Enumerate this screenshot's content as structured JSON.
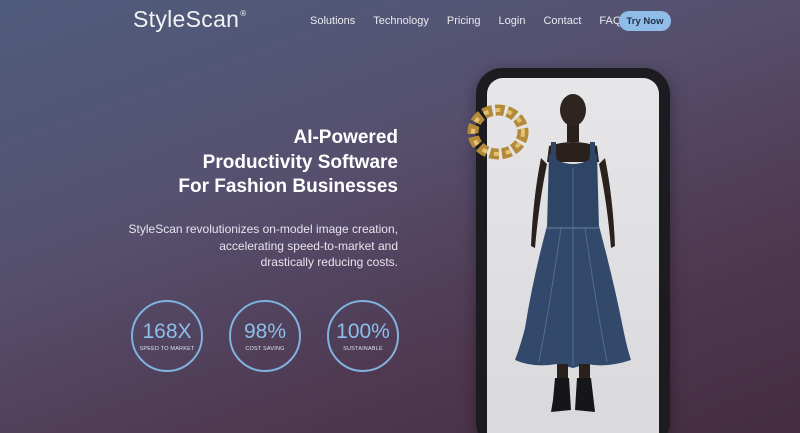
{
  "brand": {
    "name": "StyleScan",
    "mark": "®"
  },
  "nav": {
    "items": [
      "Solutions",
      "Technology",
      "Pricing",
      "Login",
      "Contact",
      "FAQ"
    ],
    "cta_label": "Try Now"
  },
  "hero": {
    "headline_lines": [
      "AI-Powered",
      "Productivity Software",
      "For Fashion Businesses"
    ],
    "description_lines": [
      "StyleScan revolutionizes on-model image creation,",
      "accelerating speed-to-market and",
      "drastically reducing costs."
    ]
  },
  "stats": [
    {
      "value": "168X",
      "label": "SPEED TO MARKET"
    },
    {
      "value": "98%",
      "label": "COST SAVING"
    },
    {
      "value": "100%",
      "label": "SUSTAINABLE"
    }
  ],
  "colors": {
    "accent": "#8fbde8",
    "stat_ring": "#7fb2de",
    "background_top": "#4f5c7c",
    "background_bottom": "#452c40",
    "phone_frame": "#1c1b20",
    "denim": "#2f4565"
  }
}
